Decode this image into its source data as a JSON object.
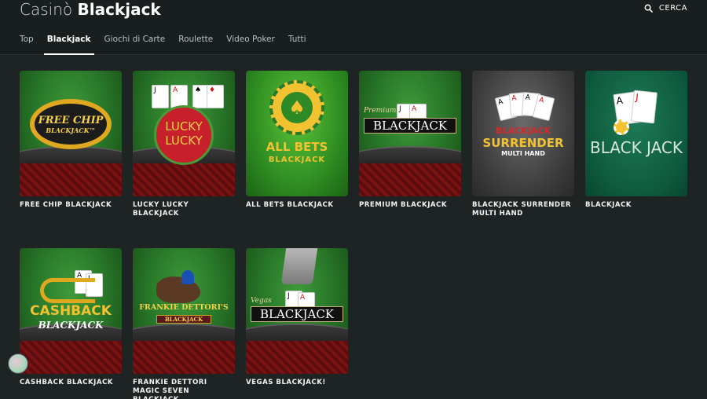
{
  "header": {
    "title_light": "Casinò",
    "title_bold": "Blackjack",
    "search_label": "CERCA"
  },
  "tabs": [
    {
      "label": "Top",
      "active": false
    },
    {
      "label": "Blackjack",
      "active": true
    },
    {
      "label": "Giochi di Carte",
      "active": false
    },
    {
      "label": "Roulette",
      "active": false
    },
    {
      "label": "Video Poker",
      "active": false
    },
    {
      "label": "Tutti",
      "active": false
    }
  ],
  "games": [
    {
      "caption": "FREE CHIP BLACKJACK",
      "logo_line1": "FREE CHIP",
      "logo_line2": "BLACKJACK™"
    },
    {
      "caption": "LUCKY LUCKY BLACKJACK",
      "logo_line1": "LUCKY",
      "logo_line2": "LUCKY"
    },
    {
      "caption": "ALL BETS BLACKJACK",
      "logo_line1": "ALL BETS",
      "logo_line2": "BLACKJACK"
    },
    {
      "caption": "PREMIUM BLACKJACK",
      "logo_line1": "Premium",
      "logo_line2": "BLACKJACK"
    },
    {
      "caption": "BLACKJACK SURRENDER MULTI HAND",
      "logo_line1": "BLACKJACK",
      "logo_line2": "SURRENDER",
      "logo_line3": "MULTI HAND"
    },
    {
      "caption": "BLACKJACK",
      "logo_line1": "BLACK JACK"
    },
    {
      "caption": "CASHBACK BLACKJACK",
      "logo_line1": "CASHBACK",
      "logo_line2": "BLACKJACK"
    },
    {
      "caption": "FRANKIE DETTORI MAGIC SEVEN BLACKJACK",
      "logo_line1": "FRANKIE DETTORI'S",
      "logo_line2": "BLACKJACK"
    },
    {
      "caption": "VEGAS BLACKJACK!",
      "logo_line1": "Vegas",
      "logo_line2": "BLACKJACK"
    }
  ],
  "colors": {
    "background": "#1e2424",
    "header_bg": "#191e1e",
    "felt_green": "#2a7a2a",
    "gold": "#f2c230"
  }
}
